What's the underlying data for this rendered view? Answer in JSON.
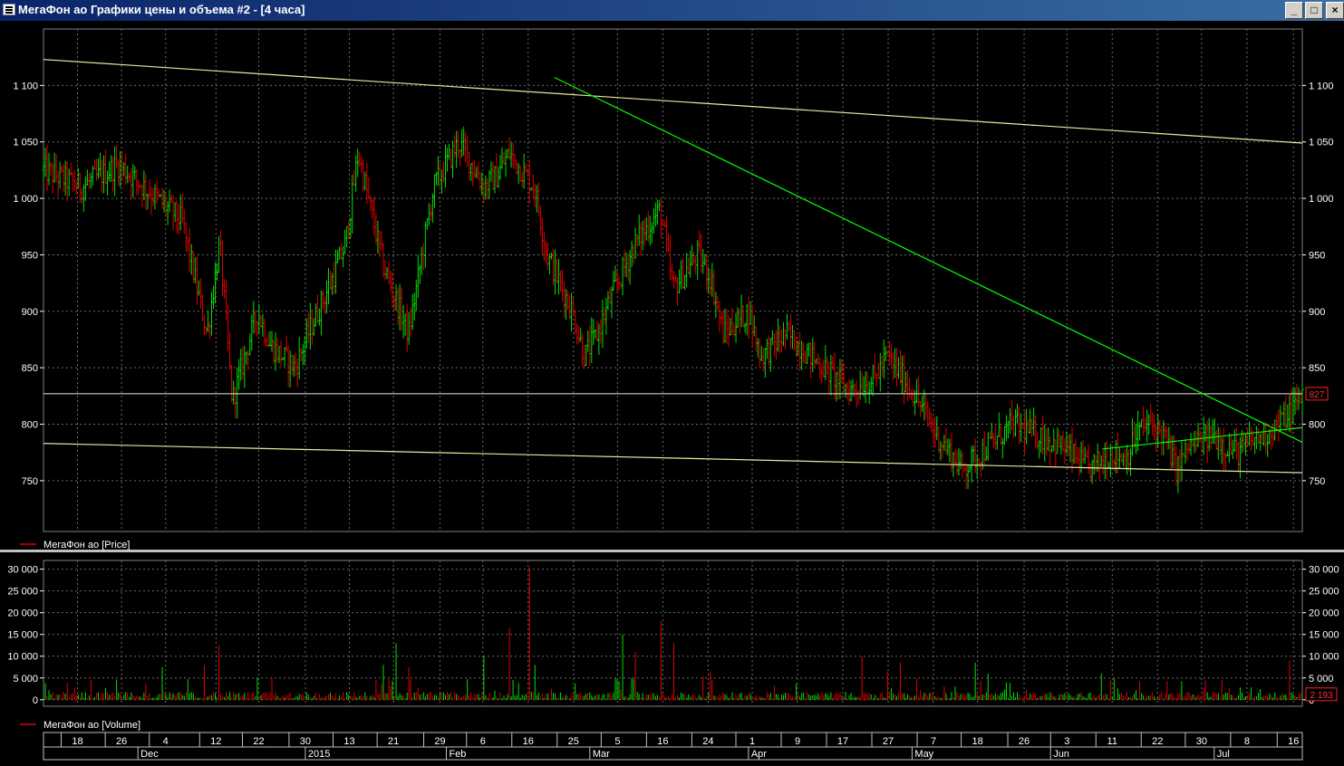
{
  "window": {
    "title": "МегаФон ао Графики цены и объема #2 - [4 часа]",
    "buttons": {
      "minimize": "_",
      "maximize": "□",
      "close": "×"
    }
  },
  "chart_data": [
    {
      "type": "bar",
      "subtype": "ohlc-price",
      "legend": "МегаФон ао [Price]",
      "y_ticks": [
        750,
        800,
        850,
        900,
        950,
        1000,
        1050,
        1100
      ],
      "y_tick_labels": [
        "750",
        "800",
        "850",
        "900",
        "950",
        "1 000",
        "1 050",
        "1 100"
      ],
      "ylim": [
        705,
        1150
      ],
      "last_value_label": "827",
      "last_value": 827,
      "horizontal_line": 827,
      "grid": true,
      "colors": {
        "up": "#00e000",
        "down": "#e00000",
        "trend_upper": "#e8e8a0",
        "trend_lower": "#e8e8a0",
        "trend_green": "#00ff00"
      },
      "series": [
        {
          "name": "МегаФон ао [Price]",
          "x": [
            0.0,
            0.03,
            0.06,
            0.09,
            0.11,
            0.13,
            0.14,
            0.15,
            0.17,
            0.18,
            0.2,
            0.21,
            0.23,
            0.24,
            0.25,
            0.27,
            0.29,
            0.31,
            0.33,
            0.34,
            0.35,
            0.36,
            0.37,
            0.39,
            0.4,
            0.42,
            0.43,
            0.44,
            0.45,
            0.47,
            0.49,
            0.5,
            0.52,
            0.53,
            0.54,
            0.56,
            0.57,
            0.59,
            0.6,
            0.62,
            0.64,
            0.66,
            0.67,
            0.69,
            0.7,
            0.71,
            0.73,
            0.75,
            0.77,
            0.79,
            0.81,
            0.83,
            0.85,
            0.86,
            0.87,
            0.88,
            0.89,
            0.9,
            0.91,
            0.92,
            0.93,
            0.94,
            0.95,
            0.96,
            0.97,
            0.98,
            0.99,
            1.0
          ],
          "values": [
            1025,
            1010,
            1030,
            1000,
            980,
            880,
            960,
            820,
            900,
            870,
            850,
            880,
            930,
            960,
            1040,
            940,
            880,
            1010,
            1050,
            1030,
            1010,
            1020,
            1040,
            1010,
            950,
            900,
            860,
            880,
            910,
            960,
            990,
            920,
            950,
            930,
            880,
            900,
            860,
            880,
            870,
            850,
            830,
            840,
            860,
            830,
            810,
            790,
            760,
            780,
            800,
            790,
            780,
            760,
            775,
            770,
            795,
            800,
            790,
            760,
            780,
            785,
            790,
            780,
            775,
            785,
            790,
            800,
            810,
            827
          ]
        }
      ],
      "trendlines": [
        {
          "from": [
            0.0,
            1123
          ],
          "to": [
            1.0,
            1049
          ],
          "color": "#e8e8a0"
        },
        {
          "from": [
            0.0,
            783
          ],
          "to": [
            1.0,
            757
          ],
          "color": "#e8e8a0"
        },
        {
          "from": [
            0.406,
            1107
          ],
          "to": [
            1.0,
            784
          ],
          "color": "#00ff00"
        },
        {
          "from": [
            0.841,
            778
          ],
          "to": [
            1.0,
            797
          ],
          "color": "#00ff00"
        }
      ]
    },
    {
      "type": "bar",
      "subtype": "volume",
      "legend": "МегаФон ао [Volume]",
      "y_ticks": [
        0,
        5000,
        10000,
        15000,
        20000,
        25000,
        30000
      ],
      "y_tick_labels": [
        "0",
        "5 000",
        "10 000",
        "15 000",
        "20 000",
        "25 000",
        "30 000"
      ],
      "ylim": [
        -1500,
        32000
      ],
      "last_value_label": "2 193",
      "last_value": 2193,
      "spikes": [
        {
          "x": 0.095,
          "value": 7500
        },
        {
          "x": 0.128,
          "value": 8000
        },
        {
          "x": 0.139,
          "value": 12500
        },
        {
          "x": 0.27,
          "value": 8000
        },
        {
          "x": 0.28,
          "value": 13000
        },
        {
          "x": 0.29,
          "value": 7500
        },
        {
          "x": 0.35,
          "value": 10000
        },
        {
          "x": 0.37,
          "value": 16500
        },
        {
          "x": 0.386,
          "value": 30500
        },
        {
          "x": 0.39,
          "value": 8000
        },
        {
          "x": 0.46,
          "value": 15000
        },
        {
          "x": 0.47,
          "value": 11000
        },
        {
          "x": 0.49,
          "value": 18000
        },
        {
          "x": 0.5,
          "value": 13000
        },
        {
          "x": 0.53,
          "value": 6500
        },
        {
          "x": 0.65,
          "value": 10000
        },
        {
          "x": 0.67,
          "value": 6500
        },
        {
          "x": 0.68,
          "value": 8500
        },
        {
          "x": 0.74,
          "value": 8500
        },
        {
          "x": 0.75,
          "value": 6000
        },
        {
          "x": 0.84,
          "value": 6000
        },
        {
          "x": 0.85,
          "value": 5000
        },
        {
          "x": 0.99,
          "value": 9000
        }
      ]
    }
  ],
  "x_axis": {
    "days": [
      {
        "label": "18",
        "x": 0.027
      },
      {
        "label": "26",
        "x": 0.062
      },
      {
        "label": "4",
        "x": 0.097
      },
      {
        "label": "12",
        "x": 0.137
      },
      {
        "label": "22",
        "x": 0.171
      },
      {
        "label": "30",
        "x": 0.208
      },
      {
        "label": "13",
        "x": 0.243
      },
      {
        "label": "21",
        "x": 0.278
      },
      {
        "label": "29",
        "x": 0.315
      },
      {
        "label": "6",
        "x": 0.349
      },
      {
        "label": "16",
        "x": 0.385
      },
      {
        "label": "25",
        "x": 0.421
      },
      {
        "label": "5",
        "x": 0.456
      },
      {
        "label": "16",
        "x": 0.492
      },
      {
        "label": "24",
        "x": 0.528
      },
      {
        "label": "1",
        "x": 0.563
      },
      {
        "label": "9",
        "x": 0.599
      },
      {
        "label": "17",
        "x": 0.635
      },
      {
        "label": "27",
        "x": 0.671
      },
      {
        "label": "7",
        "x": 0.707
      },
      {
        "label": "18",
        "x": 0.742
      },
      {
        "label": "26",
        "x": 0.779
      },
      {
        "label": "3",
        "x": 0.813
      },
      {
        "label": "11",
        "x": 0.849
      },
      {
        "label": "22",
        "x": 0.885
      },
      {
        "label": "30",
        "x": 0.92
      },
      {
        "label": "8",
        "x": 0.956
      },
      {
        "label": "16",
        "x": 0.993
      }
    ],
    "months": [
      {
        "label": "Dec",
        "x": 0.075
      },
      {
        "label": "2015",
        "x": 0.208
      },
      {
        "label": "Feb",
        "x": 0.32
      },
      {
        "label": "Mar",
        "x": 0.434
      },
      {
        "label": "Apr",
        "x": 0.56
      },
      {
        "label": "May",
        "x": 0.69
      },
      {
        "label": "Jun",
        "x": 0.8
      },
      {
        "label": "Jul",
        "x": 0.93
      }
    ]
  }
}
